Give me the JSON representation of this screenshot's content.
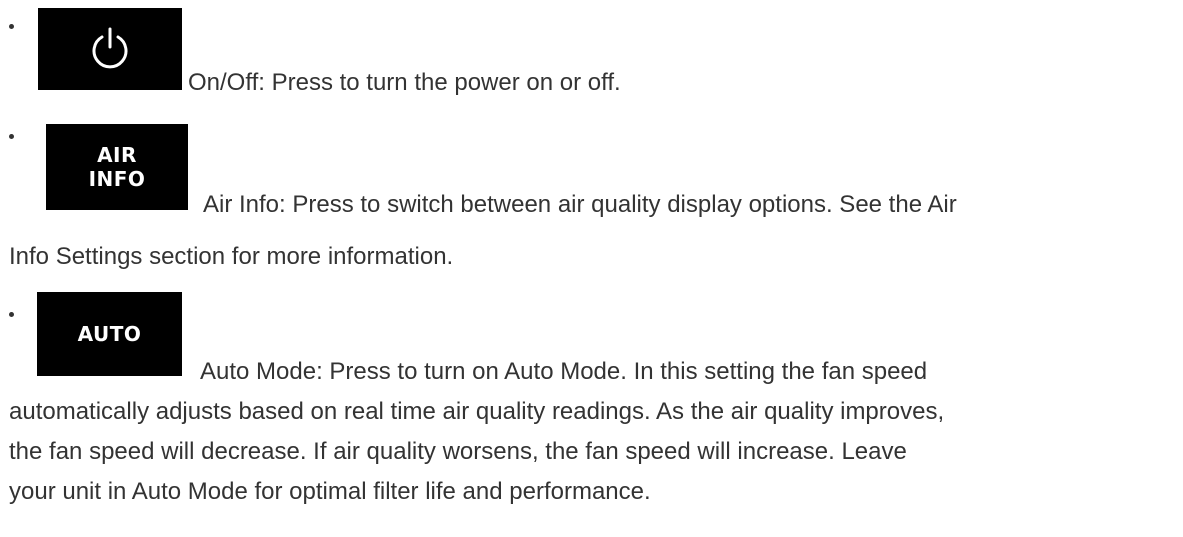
{
  "items": [
    {
      "icon": "power-icon",
      "icon_label": "",
      "text": "On/Off: Press to turn the power on or off."
    },
    {
      "icon": "air-info-icon",
      "icon_label_line1": "AIR",
      "icon_label_line2": "INFO",
      "text_line1": "Air Info: Press to switch between air quality display options. See the Air",
      "text_line2": "Info Settings section for more information."
    },
    {
      "icon": "auto-icon",
      "icon_label": "AUTO",
      "text_line1": "Auto Mode: Press to turn on Auto Mode. In this setting the fan speed",
      "text_line2": "automatically adjusts based on real time air quality readings. As the air quality improves,",
      "text_line3": "the fan speed will decrease. If air quality worsens, the fan speed will increase. Leave",
      "text_line4": "your unit in Auto Mode for optimal filter life and performance."
    }
  ],
  "colors": {
    "text": "#333333",
    "icon_bg": "#000000",
    "icon_fg": "#ffffff"
  }
}
